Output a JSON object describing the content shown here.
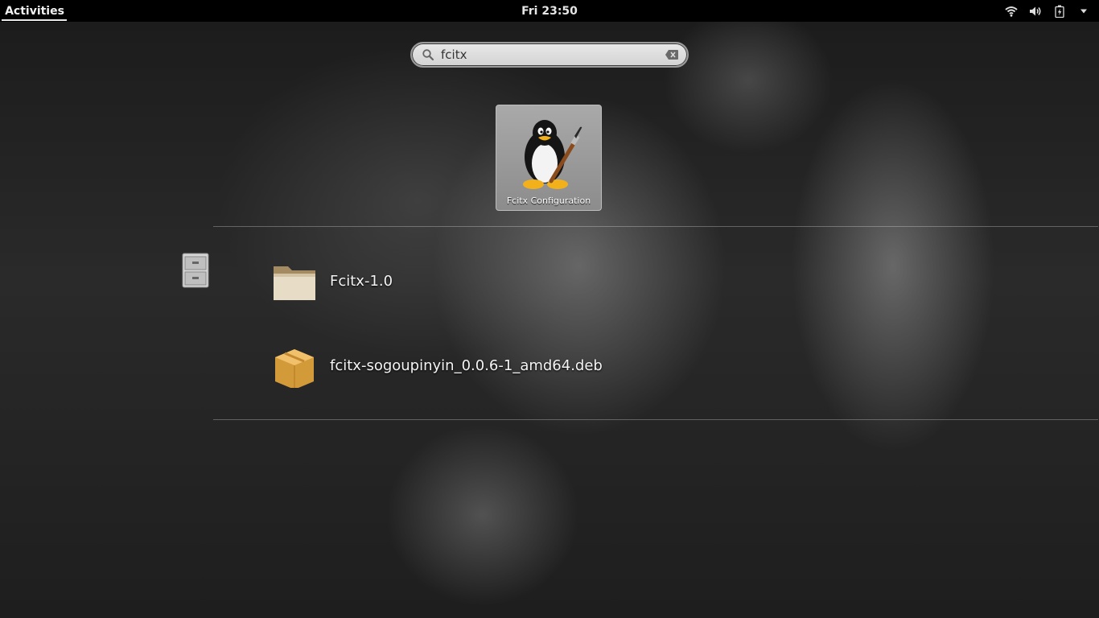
{
  "topbar": {
    "activities_label": "Activities",
    "clock": "Fri 23:50",
    "tray_icons": [
      "wifi-icon",
      "volume-icon",
      "battery-icon",
      "dropdown-arrow-icon"
    ]
  },
  "search": {
    "value": "fcitx",
    "placeholder": ""
  },
  "applications": [
    {
      "name": "Fcitx Configuration",
      "icon": "penguin-paintbrush-icon"
    }
  ],
  "files": {
    "provider_icon": "file-cabinet-icon",
    "items": [
      {
        "name": "Fcitx-1.0",
        "icon": "folder-icon"
      },
      {
        "name": "fcitx-sogoupinyin_0.0.6-1_amd64.deb",
        "icon": "package-box-icon"
      }
    ]
  },
  "colors": {
    "topbar_bg": "#000000",
    "tile_bg": "#9a9a9a",
    "search_bg": "#dcdcdc"
  }
}
